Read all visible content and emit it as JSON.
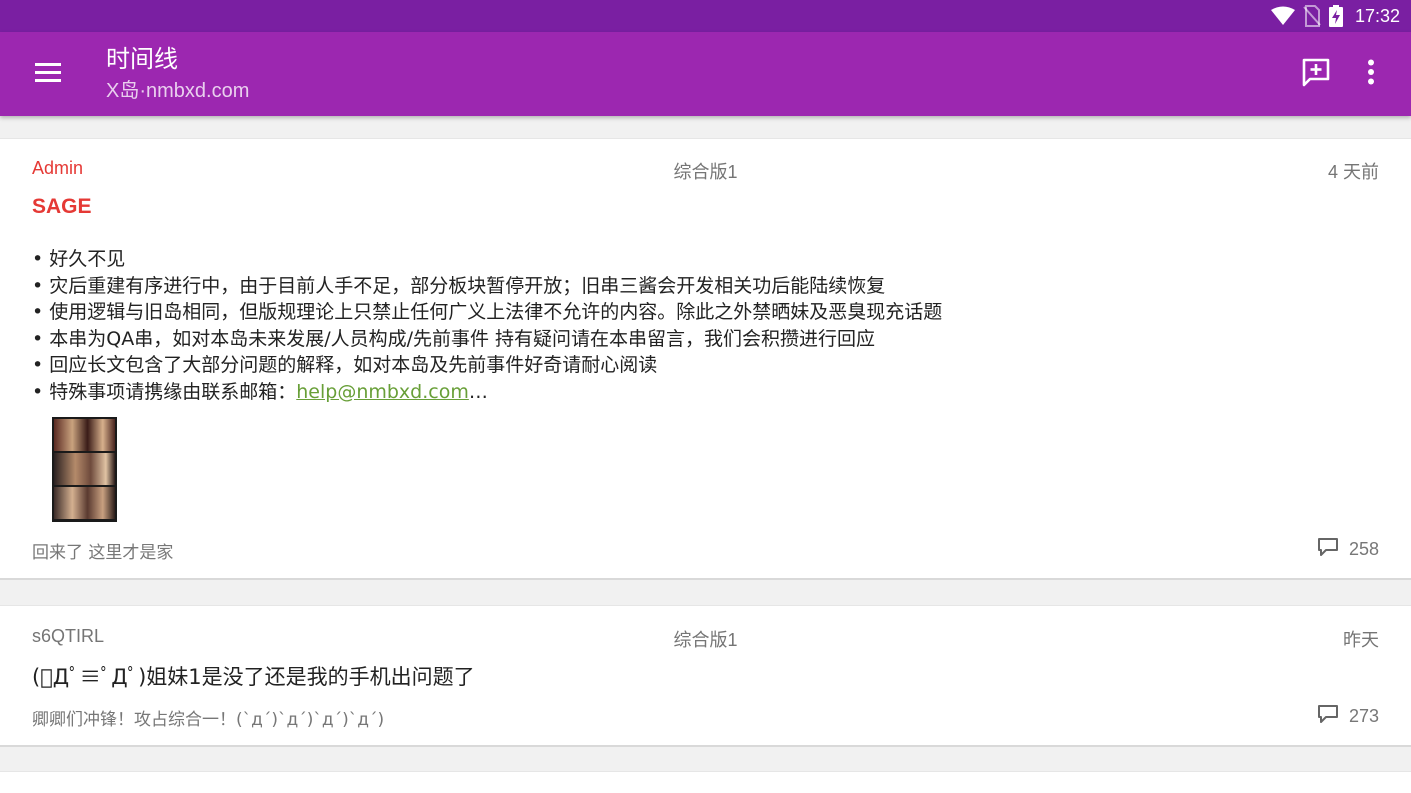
{
  "status_bar": {
    "time": "17:32",
    "icons": [
      "wifi-icon",
      "no-sim-icon",
      "battery-charging-icon"
    ]
  },
  "app_bar": {
    "title": "时间线",
    "subtitle": "X岛·nmbxd.com",
    "icons": [
      "menu-icon",
      "new-thread-icon",
      "more-vert-icon"
    ]
  },
  "threads": [
    {
      "user": "Admin",
      "forum": "综合版1",
      "time": "4 天前",
      "sage": "SAGE",
      "lines": [
        "• 好久不见",
        "• 灾后重建有序进行中，由于目前人手不足，部分板块暂停开放；旧串三酱会开发相关功后能陆续恢复",
        "• 使用逻辑与旧岛相同，但版规理论上只禁止任何广义上法律不允许的内容。除此之外禁晒妹及恶臭现充话题",
        "• 本串为QA串，如对本岛未来发展/人员构成/先前事件 持有疑问请在本串留言，我们会积攒进行回应",
        "• 回应长文包含了大部分问题的解释，如对本岛及先前事件好奇请耐心阅读"
      ],
      "last_line_prefix": "• 特殊事项请携缘由联系邮箱：",
      "email": "help@nmbxd.com",
      "ellipsis": "…",
      "footer": "回来了 这里才是家",
      "replies": "258"
    },
    {
      "user": "s6QTIRL",
      "forum": "综合版1",
      "time": "昨天",
      "title": "(ﾟДﾟ≡ﾟДﾟ)姐妹1是没了还是我的手机出问题了",
      "footer": "卿卿们冲锋！攻占综合一！(`д´)`д´)`д´)`д´)",
      "replies": "273"
    }
  ],
  "colors": {
    "status_bar": "#7a1fa2",
    "app_bar": "#9c27b0",
    "admin": "#e53935",
    "link": "#689f38"
  }
}
